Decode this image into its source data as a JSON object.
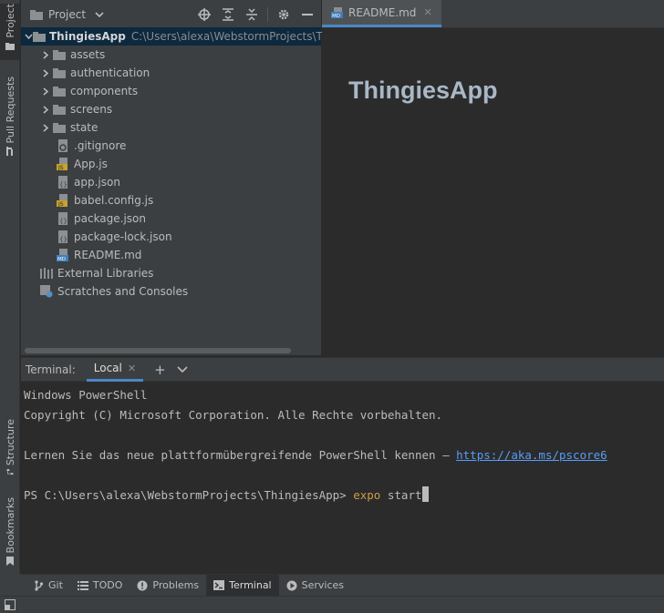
{
  "left_strip": {
    "project_label": "Project",
    "pull_requests_label": "Pull Requests",
    "structure_label": "Structure",
    "bookmarks_label": "Bookmarks"
  },
  "project_panel": {
    "title": "Project",
    "root": {
      "name": "ThingiesApp",
      "path": "C:\\Users\\alexa\\WebstormProjects\\ThingiesApp"
    },
    "folders": [
      "assets",
      "authentication",
      "components",
      "screens",
      "state"
    ],
    "files": [
      ".gitignore",
      "App.js",
      "app.json",
      "babel.config.js",
      "package.json",
      "package-lock.json",
      "README.md"
    ],
    "external_libraries": "External Libraries",
    "scratches": "Scratches and Consoles"
  },
  "editor": {
    "tab_label": "README.md",
    "heading": "ThingiesApp"
  },
  "terminal": {
    "label": "Terminal:",
    "tab_local": "Local",
    "lines": {
      "l1": "Windows PowerShell",
      "l2": "Copyright (C) Microsoft Corporation. Alle Rechte vorbehalten.",
      "l3_text": "Lernen Sie das neue plattformübergreifende PowerShell kennen – ",
      "l3_link": "https://aka.ms/pscore6",
      "prompt": "PS C:\\Users\\alexa\\WebstormProjects\\ThingiesApp> ",
      "cmd": "expo",
      "arg": " start"
    }
  },
  "bottom_bar": {
    "git": "Git",
    "todo": "TODO",
    "problems": "Problems",
    "terminal": "Terminal",
    "services": "Services"
  },
  "colors": {
    "accent": "#4a88c7",
    "folder": "#8c9092",
    "js_badge": "#c7a22d",
    "md_badge": "#3f7fbf"
  }
}
